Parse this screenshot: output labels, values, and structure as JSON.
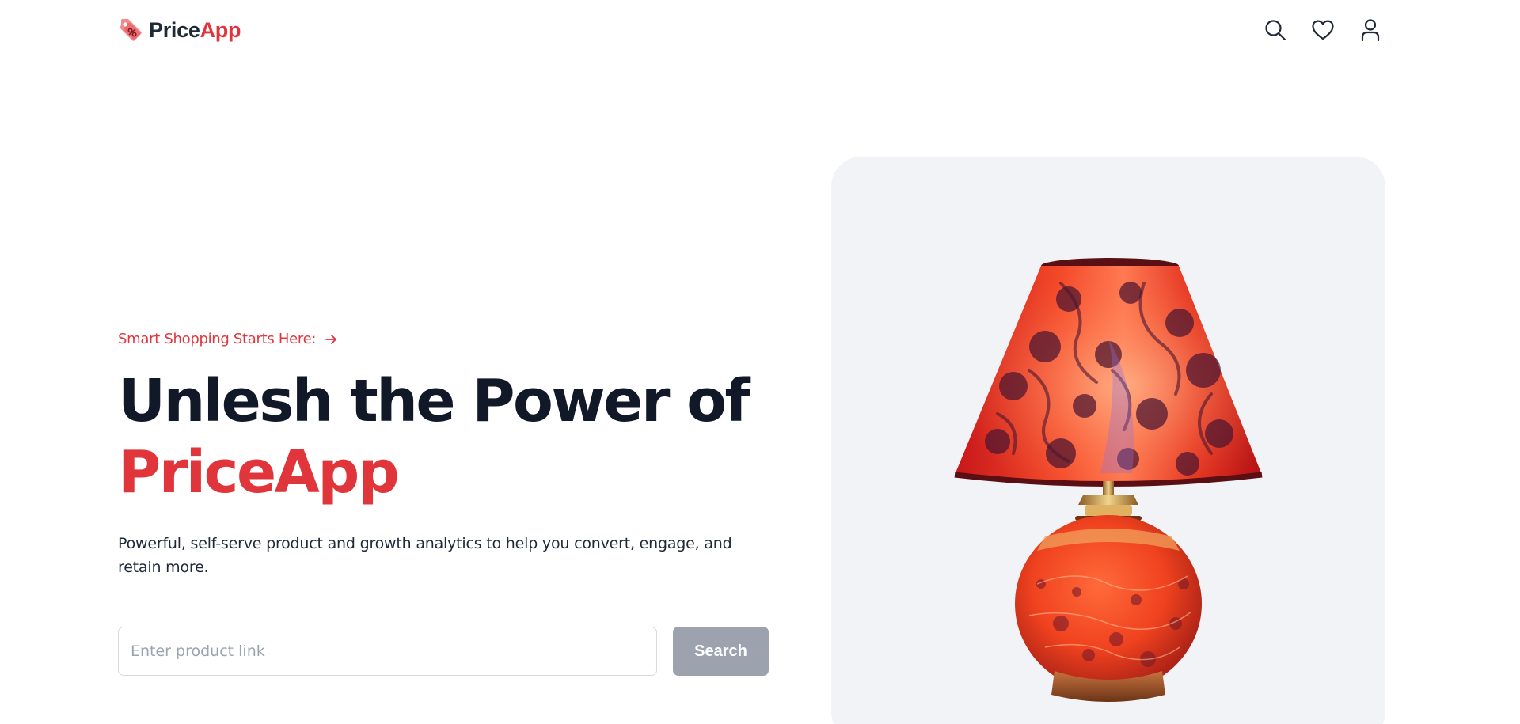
{
  "header": {
    "logo": {
      "text_primary": "Price",
      "text_accent": "App",
      "icon": "price-tag-icon"
    },
    "icons": [
      "search-icon",
      "heart-icon",
      "user-icon"
    ]
  },
  "hero": {
    "eyebrow": "Smart Shopping Starts Here:",
    "eyebrow_icon": "arrow-right-icon",
    "headline_line1": "Unlesh the Power of",
    "headline_line2": "PriceApp",
    "description": "Powerful, self-serve product and growth analytics to help you convert, engage, and retain more.",
    "search": {
      "placeholder": "Enter product link",
      "value": "",
      "button_label": "Search"
    },
    "image": {
      "icon": "table-lamp-illustration"
    }
  },
  "scrollbar": {
    "up_arrow": "▲",
    "down_arrow": "▼"
  },
  "colors": {
    "accent": "#e0353b",
    "heading": "#111827",
    "button_disabled": "#9ca3af",
    "card_bg": "#f2f3f6"
  }
}
